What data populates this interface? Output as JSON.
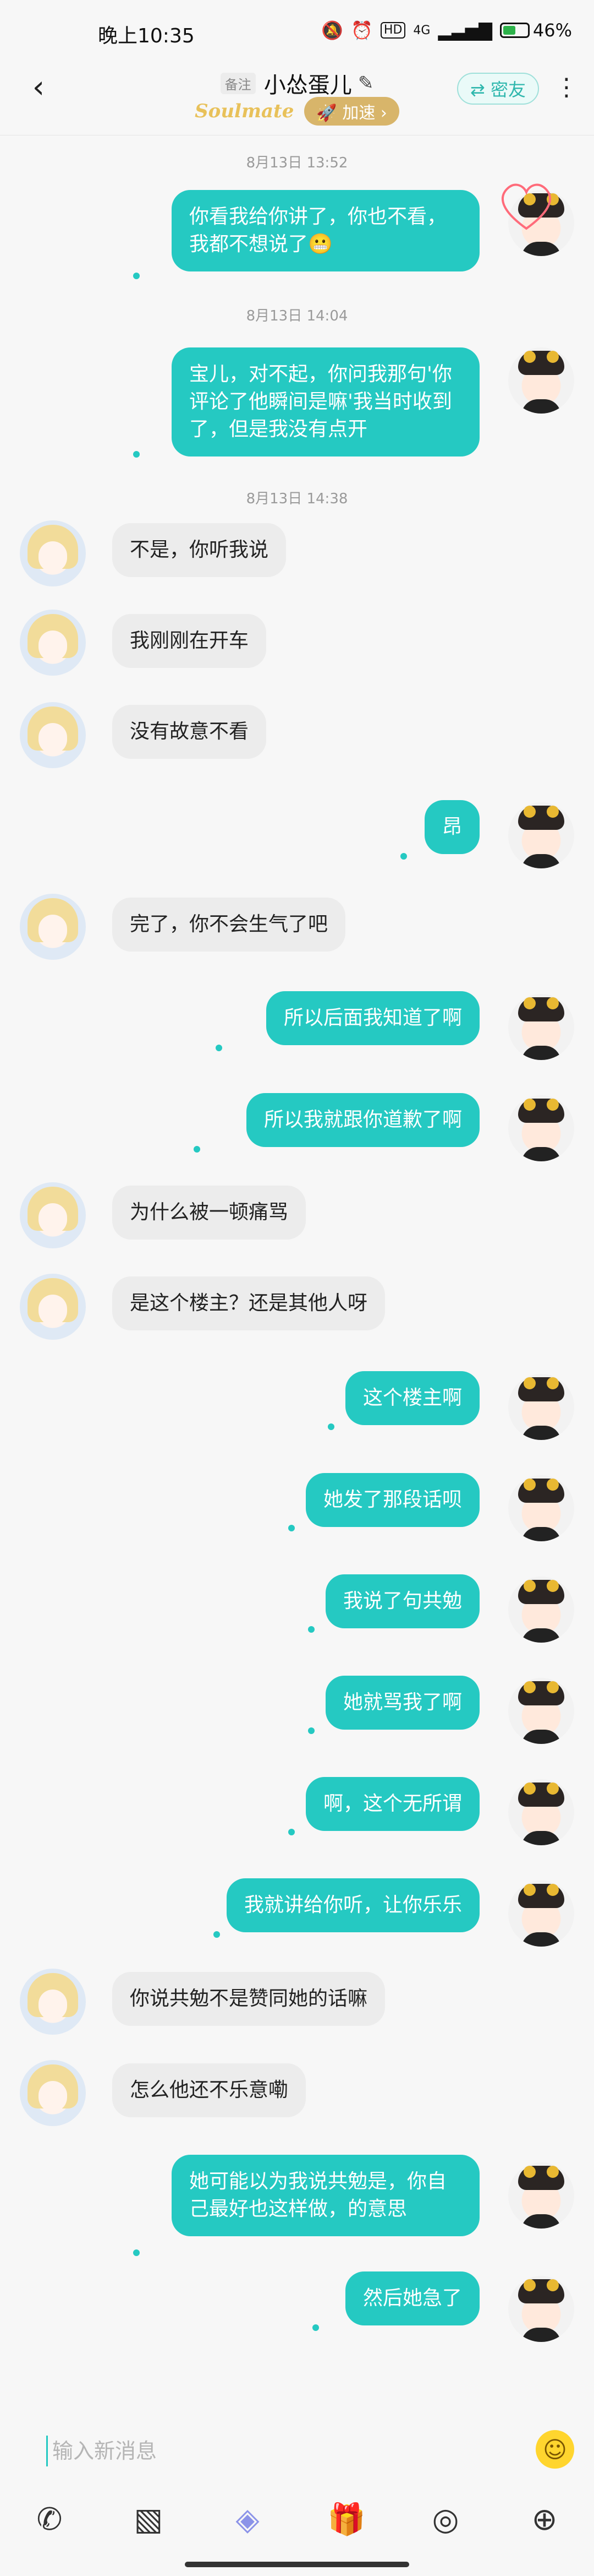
{
  "status_bar": {
    "time": "晚上10:35",
    "network": "4G",
    "hd": "HD",
    "battery_percent": "46%",
    "battery_level": 0.46
  },
  "header": {
    "remark_tag": "备注",
    "name": "小怂蛋儿",
    "badge": "Soulmate",
    "speed_label": "加速",
    "close_friend_label": "密友"
  },
  "chat": {
    "timestamps": [
      "8月13日 13:52",
      "8月13日 14:04",
      "8月13日 14:38"
    ],
    "messages": [
      {
        "from": "me",
        "text": "你看我给你讲了，你也不看，我都不想说了😬"
      },
      {
        "from": "me",
        "text": "宝儿，对不起，你问我那句'你评论了他瞬间是嘛'我当时收到了，但是我没有点开"
      },
      {
        "from": "her",
        "text": "不是，你听我说"
      },
      {
        "from": "her",
        "text": "我刚刚在开车"
      },
      {
        "from": "her",
        "text": "没有故意不看"
      },
      {
        "from": "me",
        "text": "昂"
      },
      {
        "from": "her",
        "text": "完了，你不会生气了吧"
      },
      {
        "from": "me",
        "text": "所以后面我知道了啊"
      },
      {
        "from": "me",
        "text": "所以我就跟你道歉了啊"
      },
      {
        "from": "her",
        "text": "为什么被一顿痛骂"
      },
      {
        "from": "her",
        "text": "是这个楼主？还是其他人呀"
      },
      {
        "from": "me",
        "text": "这个楼主啊"
      },
      {
        "from": "me",
        "text": "她发了那段话呗"
      },
      {
        "from": "me",
        "text": "我说了句共勉"
      },
      {
        "from": "me",
        "text": "她就骂我了啊"
      },
      {
        "from": "me",
        "text": "啊，这个无所谓"
      },
      {
        "from": "me",
        "text": "我就讲给你听，让你乐乐"
      },
      {
        "from": "her",
        "text": "你说共勉不是赞同她的话嘛"
      },
      {
        "from": "her",
        "text": "怎么他还不乐意嘞"
      },
      {
        "from": "me",
        "text": "她可能以为我说共勉是，你自己最好也这样做，的意思"
      },
      {
        "from": "me",
        "text": "然后她急了"
      }
    ]
  },
  "input": {
    "placeholder": "输入新消息"
  },
  "toolbar": {
    "icons": [
      "phone-icon",
      "image-icon",
      "cube-icon",
      "gift-icon",
      "voice-icon",
      "plus-icon"
    ]
  },
  "colors": {
    "accent": "#25c9c2",
    "her_bubble": "#ececec",
    "gold": "#d8b56a"
  }
}
